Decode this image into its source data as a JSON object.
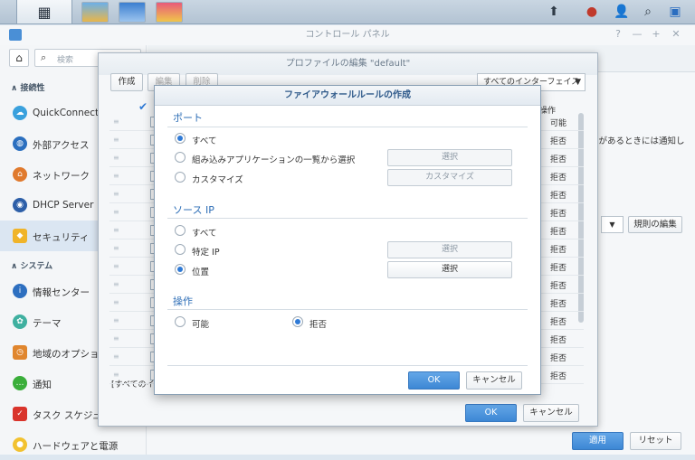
{
  "taskbar": {
    "icons": [
      "grid-icon",
      "package-icon",
      "notes-icon",
      "photo-icon"
    ],
    "tray": [
      "upload-icon",
      "chat-icon",
      "user-icon",
      "search-icon",
      "widget-icon"
    ]
  },
  "cp": {
    "title": "コントロール パネル",
    "search_placeholder": "検索",
    "sections": {
      "connectivity": "接続性",
      "system": "システム"
    },
    "nav": [
      "QuickConnect",
      "外部アクセス",
      "ネットワーク",
      "DHCP Server",
      "セキュリティ",
      "情報センター",
      "テーマ",
      "地域のオプション",
      "通知",
      "タスク スケジューラ",
      "ハードウェアと電源"
    ],
    "notice": "ンがあるときには通知し",
    "rule_btn": "規則の編集",
    "apply": "適用",
    "reset": "リセット"
  },
  "profile": {
    "title": "プロファイルの編集 \"default\"",
    "create": "作成",
    "edit": "編集",
    "delete": "削除",
    "iface": "すべてのインターフェイス",
    "col_action": "操作",
    "rows": [
      "可能",
      "拒否",
      "拒否",
      "拒否",
      "拒否",
      "拒否",
      "拒否",
      "拒否",
      "拒否",
      "拒否",
      "拒否",
      "拒否",
      "拒否",
      "拒否",
      "拒否"
    ],
    "footer": "[すべてのイ",
    "ok": "OK",
    "cancel": "キャンセル"
  },
  "fw": {
    "title": "ファイアウォールルールの作成",
    "port": {
      "head": "ポート",
      "all": "すべて",
      "builtin": "組み込みアプリケーションの一覧から選択",
      "custom": "カスタマイズ",
      "select": "選択",
      "customize": "カスタマイズ"
    },
    "source": {
      "head": "ソース IP",
      "all": "すべて",
      "specific": "特定 IP",
      "location": "位置",
      "select": "選択"
    },
    "action": {
      "head": "操作",
      "allow": "可能",
      "deny": "拒否"
    },
    "ok": "OK",
    "cancel": "キャンセル"
  }
}
